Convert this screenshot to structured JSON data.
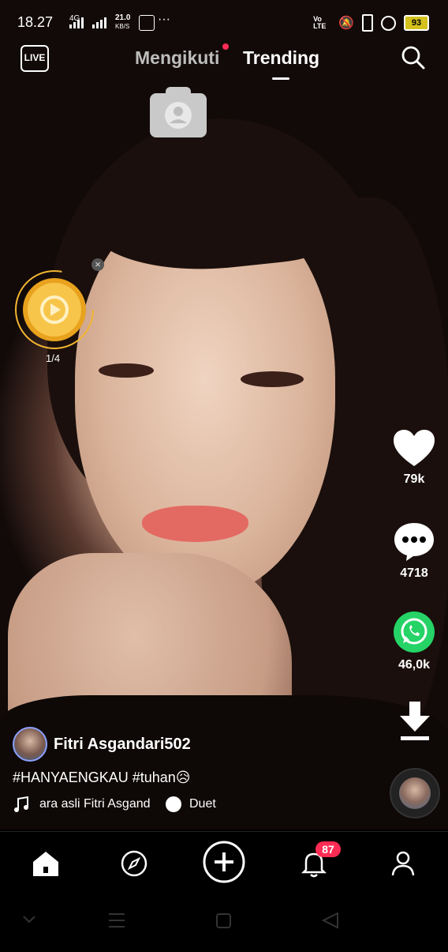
{
  "status_bar": {
    "time": "18.27",
    "network_type": "4G",
    "speed_value": "21.0",
    "speed_unit": "KB/S",
    "more": "···",
    "volte": "Vo LTE",
    "battery": "93"
  },
  "top_nav": {
    "live_label": "LIVE",
    "tab_following": "Mengikuti",
    "tab_trending": "Trending"
  },
  "coin_widget": {
    "progress": "1/4",
    "close": "×"
  },
  "actions": {
    "likes": "79k",
    "comments": "4718",
    "shares": "46,0k"
  },
  "post": {
    "username": "Fitri Asgandari502",
    "caption": "#HANYAENGKAU #tuhan😥",
    "music": "ara asli Fitri Asgand",
    "duet": "Duet"
  },
  "bottom_nav": {
    "notifications_count": "87"
  },
  "colors": {
    "accent_red": "#fe2c55",
    "whatsapp_green": "#25d366",
    "coin_gold": "#f2b531",
    "battery_yellow": "#d4c11c"
  }
}
